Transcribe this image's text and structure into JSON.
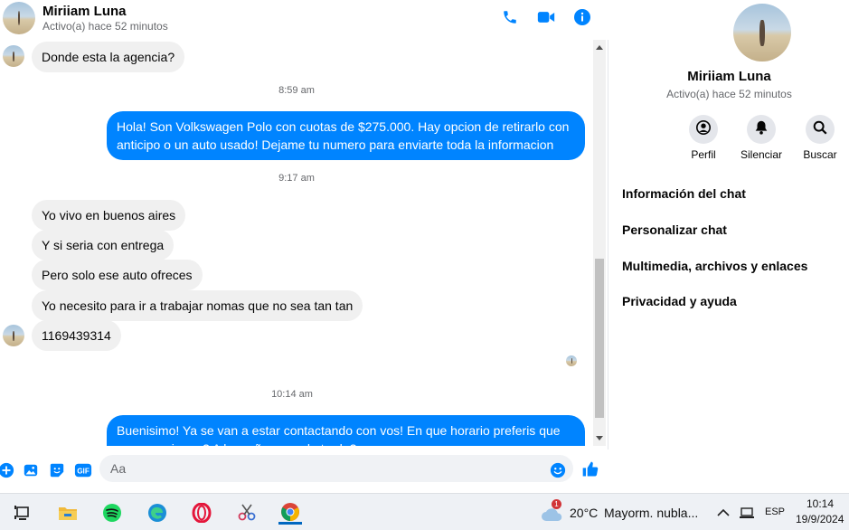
{
  "contact": {
    "name": "Miriiam Luna",
    "status": "Activo(a) hace 52 minutos"
  },
  "header_icons": [
    "phone-icon",
    "video-camera-icon",
    "info-icon"
  ],
  "messages": {
    "m1": "Donde esta la agencia?",
    "ts1": "8:59 am",
    "m2": "Hola! Son Volkswagen Polo con cuotas de $275.000. Hay opcion de retirarlo con anticipo o un auto usado! Dejame tu numero para enviarte toda la informacion",
    "ts2": "9:17 am",
    "m3": "Yo vivo en buenos aires",
    "m4": "Y si seria con entrega",
    "m5": "Pero solo ese auto ofreces",
    "m6": "Yo necesito para ir a  trabajar nomas que no sea tan tan",
    "m7": "1169439314",
    "ts3": "10:14 am",
    "m8": "Buenisimo! Ya se van a estar contactando con vos! En que horario preferis que se comuniquen? A la mañana o a la tarde?"
  },
  "composer": {
    "placeholder": "Aa",
    "icons": [
      "plus-icon",
      "image-icon",
      "sticker-icon",
      "gif-icon",
      "emoji-icon",
      "like-icon"
    ],
    "gif_label": "GIF"
  },
  "info_pane": {
    "name": "Miriiam Luna",
    "status": "Activo(a) hace 52 minutos",
    "actions": [
      {
        "label": "Perfil",
        "icon": "profile-icon"
      },
      {
        "label": "Silenciar",
        "icon": "bell-icon"
      },
      {
        "label": "Buscar",
        "icon": "search-icon"
      }
    ],
    "menu": [
      "Información del chat",
      "Personalizar chat",
      "Multimedia, archivos y enlaces",
      "Privacidad y ayuda"
    ]
  },
  "taskbar": {
    "weather_temp": "20°C",
    "weather_desc": "Mayorm. nubla...",
    "weather_badge": "1",
    "lang": "ESP",
    "time": "10:14",
    "date": "19/9/2024"
  },
  "colors": {
    "accent": "#0084ff",
    "incoming_bubble": "#f0f0f0"
  }
}
